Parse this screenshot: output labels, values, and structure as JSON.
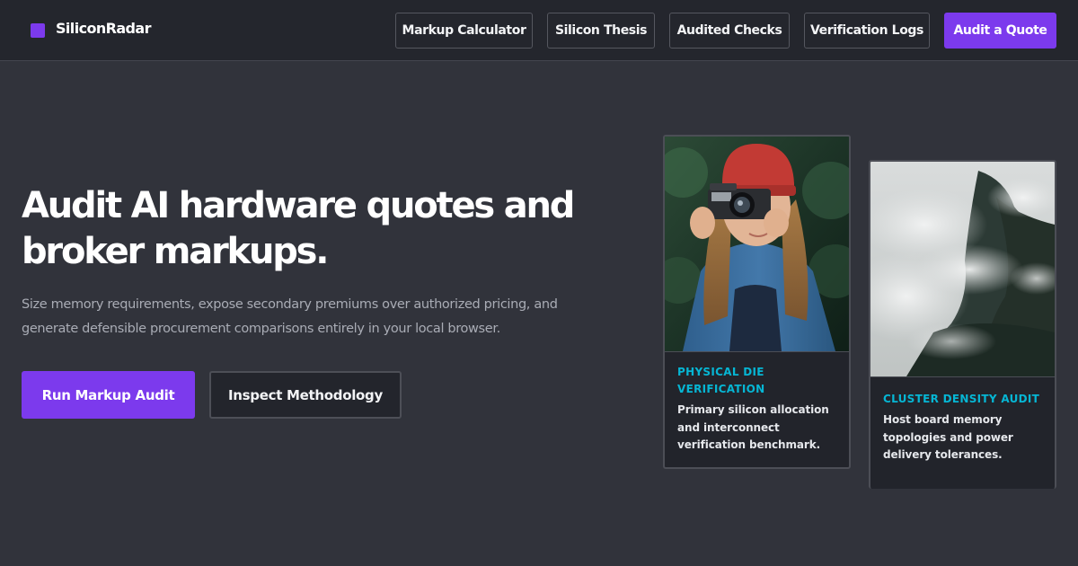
{
  "brand": {
    "name": "SiliconRadar",
    "accent_color": "#7c3aed"
  },
  "nav": {
    "items": [
      {
        "label": "Markup Calculator"
      },
      {
        "label": "Silicon Thesis"
      },
      {
        "label": "Audited Checks"
      },
      {
        "label": "Verification Logs"
      }
    ],
    "cta_label": "Audit a Quote"
  },
  "hero": {
    "title": "Audit AI hardware quotes and broker markups.",
    "subtitle": "Size memory requirements, expose secondary premiums over authorized pricing, and generate defensible procurement comparisons entirely in your local browser.",
    "primary_button": "Run Markup Audit",
    "secondary_button": "Inspect Methodology"
  },
  "cards": [
    {
      "label": "PHYSICAL DIE VERIFICATION",
      "description": "Primary silicon allocation and interconnect verification benchmark.",
      "image": "woman-with-camera-photo"
    },
    {
      "label": "CLUSTER DENSITY AUDIT",
      "description": "Host board memory topologies and power delivery tolerances.",
      "image": "misty-mountain-forest-photo"
    }
  ],
  "colors": {
    "background": "#31333b",
    "header": "#24262d",
    "card_label": "#06b6d4"
  }
}
